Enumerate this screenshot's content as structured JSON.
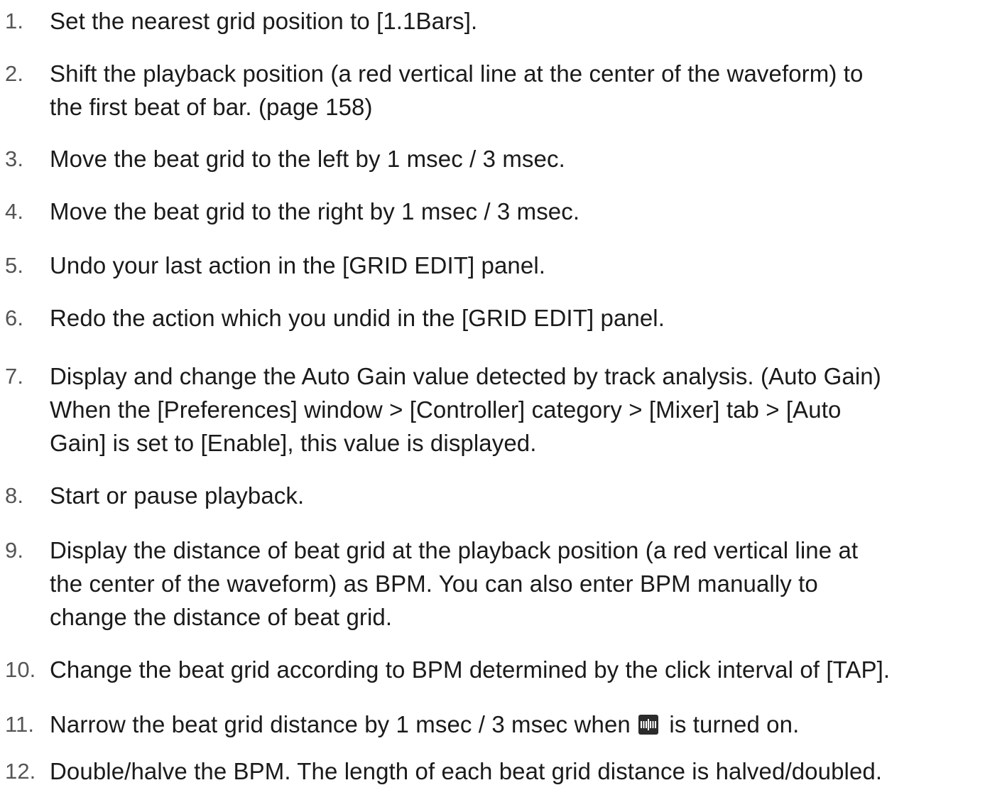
{
  "items": [
    {
      "num": "1.",
      "lines": [
        "Set the nearest grid position to [1.1Bars]."
      ]
    },
    {
      "num": "2.",
      "lines": [
        "Shift the playback position (a red vertical line at the center of the waveform) to",
        "the first beat of bar. (page 158)"
      ]
    },
    {
      "num": "3.",
      "lines": [
        "Move the beat grid to the left by 1 msec / 3 msec."
      ]
    },
    {
      "num": "4.",
      "lines": [
        "Move the beat grid to the right by 1 msec / 3 msec."
      ]
    },
    {
      "num": "5.",
      "lines": [
        "Undo your last action in the [GRID EDIT] panel."
      ]
    },
    {
      "num": "6.",
      "lines": [
        "Redo the action which you undid in the [GRID EDIT] panel."
      ]
    },
    {
      "num": "7.",
      "lines": [
        "Display and change the Auto Gain value detected by track analysis. (Auto Gain)",
        "When the [Preferences] window > [Controller] category > [Mixer] tab > [Auto",
        "Gain] is set to [Enable], this value is displayed."
      ]
    },
    {
      "num": "8.",
      "lines": [
        "Start or pause playback."
      ]
    },
    {
      "num": "9.",
      "lines": [
        "Display the distance of beat grid at the playback position (a red vertical line at",
        "the center of the waveform) as BPM. You can also enter BPM manually to",
        "change the distance of beat grid."
      ]
    },
    {
      "num": "10.",
      "lines": [
        "Change the beat grid according to BPM determined by the click interval of [TAP]."
      ]
    },
    {
      "num": "11.",
      "before_icon": "Narrow the beat grid distance by 1 msec / 3 msec when",
      "icon": "grid-adjust-icon",
      "after_icon": "is turned on."
    },
    {
      "num": "12.",
      "lines": [
        "Double/halve the BPM. The length of each beat grid distance is halved/doubled."
      ]
    }
  ]
}
